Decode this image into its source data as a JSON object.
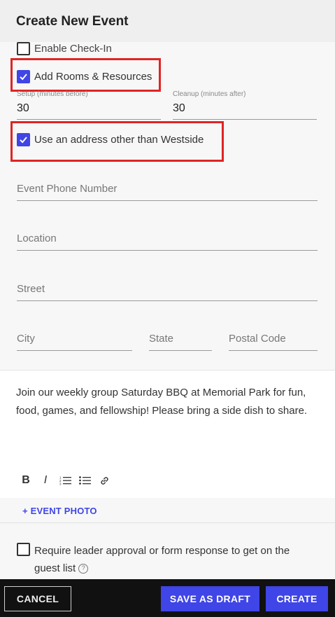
{
  "header": {
    "title": "Create New Event"
  },
  "checkboxes": {
    "enable_checkin": {
      "label": "Enable Check-In",
      "checked": false
    },
    "add_rooms": {
      "label": "Add Rooms & Resources",
      "checked": true
    },
    "other_address": {
      "label": "Use an address other than Westside",
      "checked": true
    }
  },
  "setup": {
    "label": "Setup (minutes before)",
    "value": "30"
  },
  "cleanup": {
    "label": "Cleanup (minutes after)",
    "value": "30"
  },
  "fields": {
    "phone": "Event Phone Number",
    "location": "Location",
    "street": "Street",
    "city": "City",
    "state": "State",
    "postal": "Postal Code"
  },
  "description": "Join our weekly group Saturday BBQ at Memorial Park for fun, food, games, and fellowship! Please bring a side dish to share.",
  "toolbar": {
    "bold": "B",
    "italic": "I"
  },
  "event_photo": "+ EVENT PHOTO",
  "approval": {
    "label": "Require leader approval or form response to get on the guest list",
    "help": "?"
  },
  "footer": {
    "cancel": "CANCEL",
    "save_draft": "SAVE AS DRAFT",
    "create": "CREATE"
  },
  "colors": {
    "accent": "#3f45e6",
    "highlight": "#e02424",
    "footer_bg": "#111111"
  }
}
